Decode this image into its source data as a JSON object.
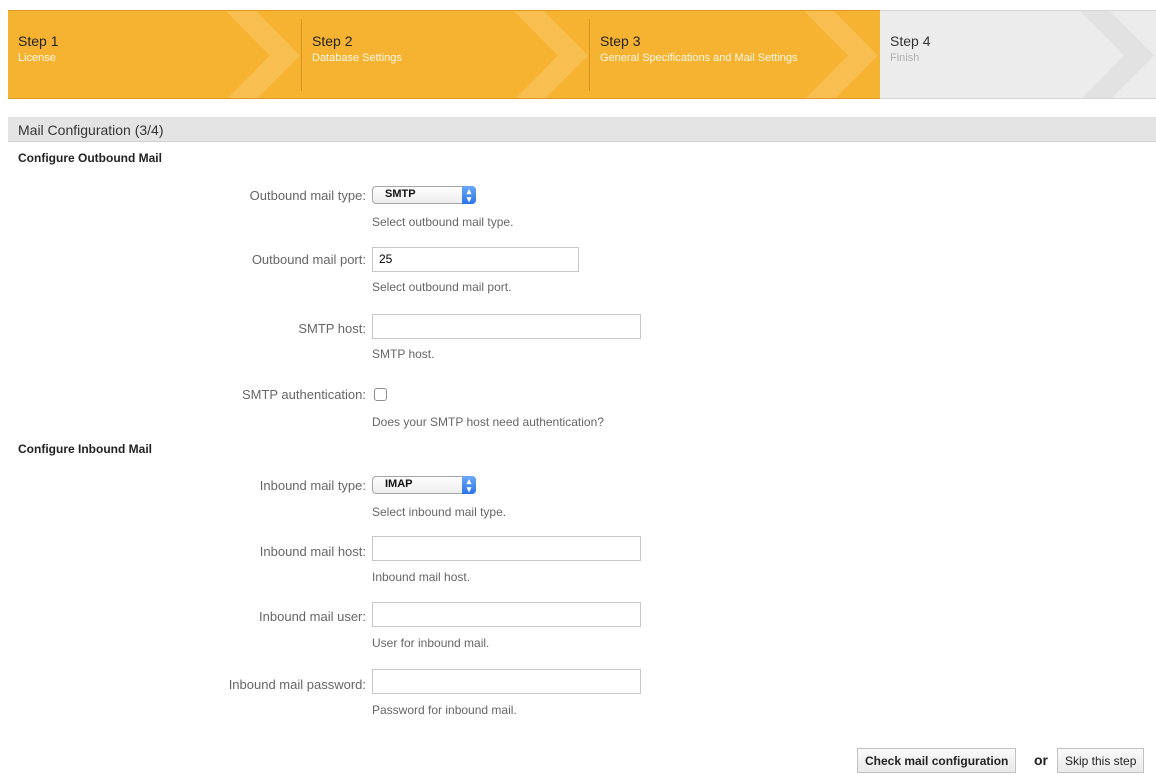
{
  "steps": [
    {
      "title": "Step 1",
      "subtitle": "License"
    },
    {
      "title": "Step 2",
      "subtitle": "Database Settings"
    },
    {
      "title": "Step 3",
      "subtitle": "General Specifications and Mail Settings"
    },
    {
      "title": "Step 4",
      "subtitle": "Finish"
    }
  ],
  "panel": {
    "title": "Mail Configuration (3/4)"
  },
  "outbound": {
    "section_title": "Configure Outbound Mail",
    "type_label": "Outbound mail type:",
    "type_value": "SMTP",
    "type_hint": "Select outbound mail type.",
    "port_label": "Outbound mail port:",
    "port_value": "25",
    "port_hint": "Select outbound mail port.",
    "host_label": "SMTP host:",
    "host_value": "",
    "host_hint": "SMTP host.",
    "auth_label": "SMTP authentication:",
    "auth_checked": false,
    "auth_hint": "Does your SMTP host need authentication?"
  },
  "inbound": {
    "section_title": "Configure Inbound Mail",
    "type_label": "Inbound mail type:",
    "type_value": "IMAP",
    "type_hint": "Select inbound mail type.",
    "host_label": "Inbound mail host:",
    "host_value": "",
    "host_hint": "Inbound mail host.",
    "user_label": "Inbound mail user:",
    "user_value": "",
    "user_hint": "User for inbound mail.",
    "password_label": "Inbound mail password:",
    "password_value": "",
    "password_hint": "Password for inbound mail."
  },
  "actions": {
    "check_label": "Check mail configuration",
    "or_label": "or",
    "skip_label": "Skip this step"
  },
  "icons": {
    "select_arrows": "select-updown-arrows-icon"
  },
  "colors": {
    "step_done": "#f6b331",
    "step_todo": "#ececec",
    "select_accent": "#2a74e6"
  }
}
